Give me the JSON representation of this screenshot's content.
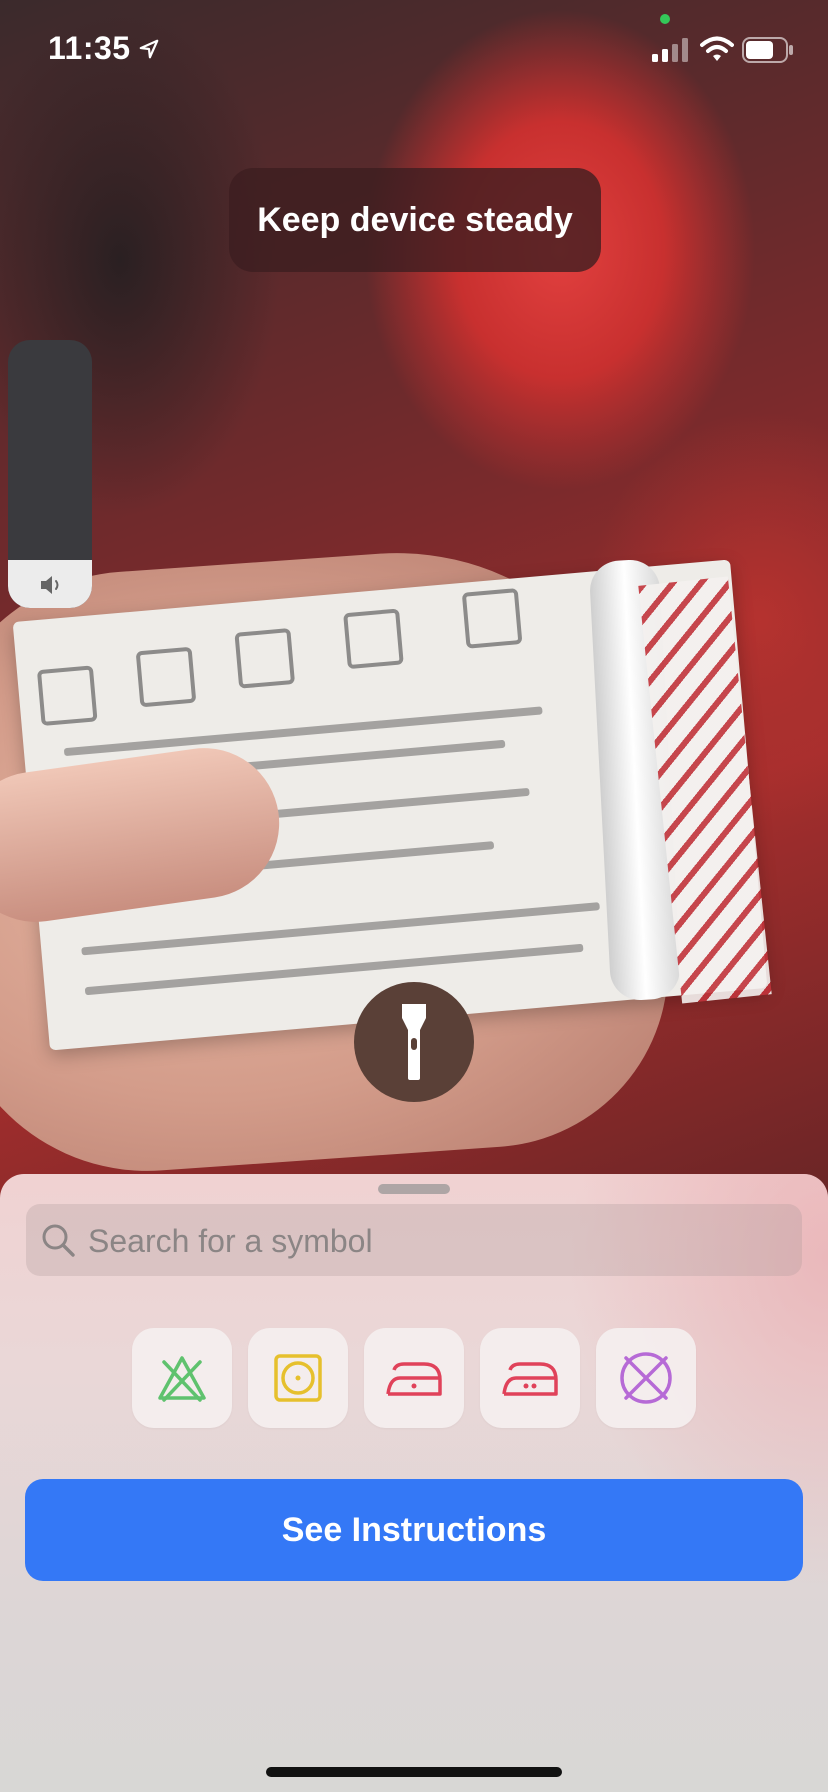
{
  "status_bar": {
    "time": "11:35",
    "location_icon": "location-arrow-icon",
    "signal_icon": "cellular-signal-icon",
    "wifi_icon": "wifi-icon",
    "battery_icon": "battery-icon",
    "camera_indicator_color": "#34c759"
  },
  "toast": {
    "message": "Keep device steady"
  },
  "volume_hud": {
    "icon": "speaker-icon",
    "level_fraction": 0.18
  },
  "camera": {
    "flashlight_icon": "flashlight-icon"
  },
  "sheet": {
    "search": {
      "placeholder": "Search for a symbol",
      "value": "",
      "icon": "magnifying-glass-icon"
    },
    "symbols": [
      {
        "name": "do-not-bleach-icon",
        "color": "#5fc26e"
      },
      {
        "name": "tumble-dry-icon",
        "color": "#e6c02d"
      },
      {
        "name": "iron-low-icon",
        "color": "#e0425a"
      },
      {
        "name": "iron-medium-icon",
        "color": "#e0425a"
      },
      {
        "name": "do-not-dry-clean-icon",
        "color": "#b66ad6"
      }
    ],
    "primary_button": {
      "label": "See Instructions",
      "color": "#3478f6"
    }
  }
}
